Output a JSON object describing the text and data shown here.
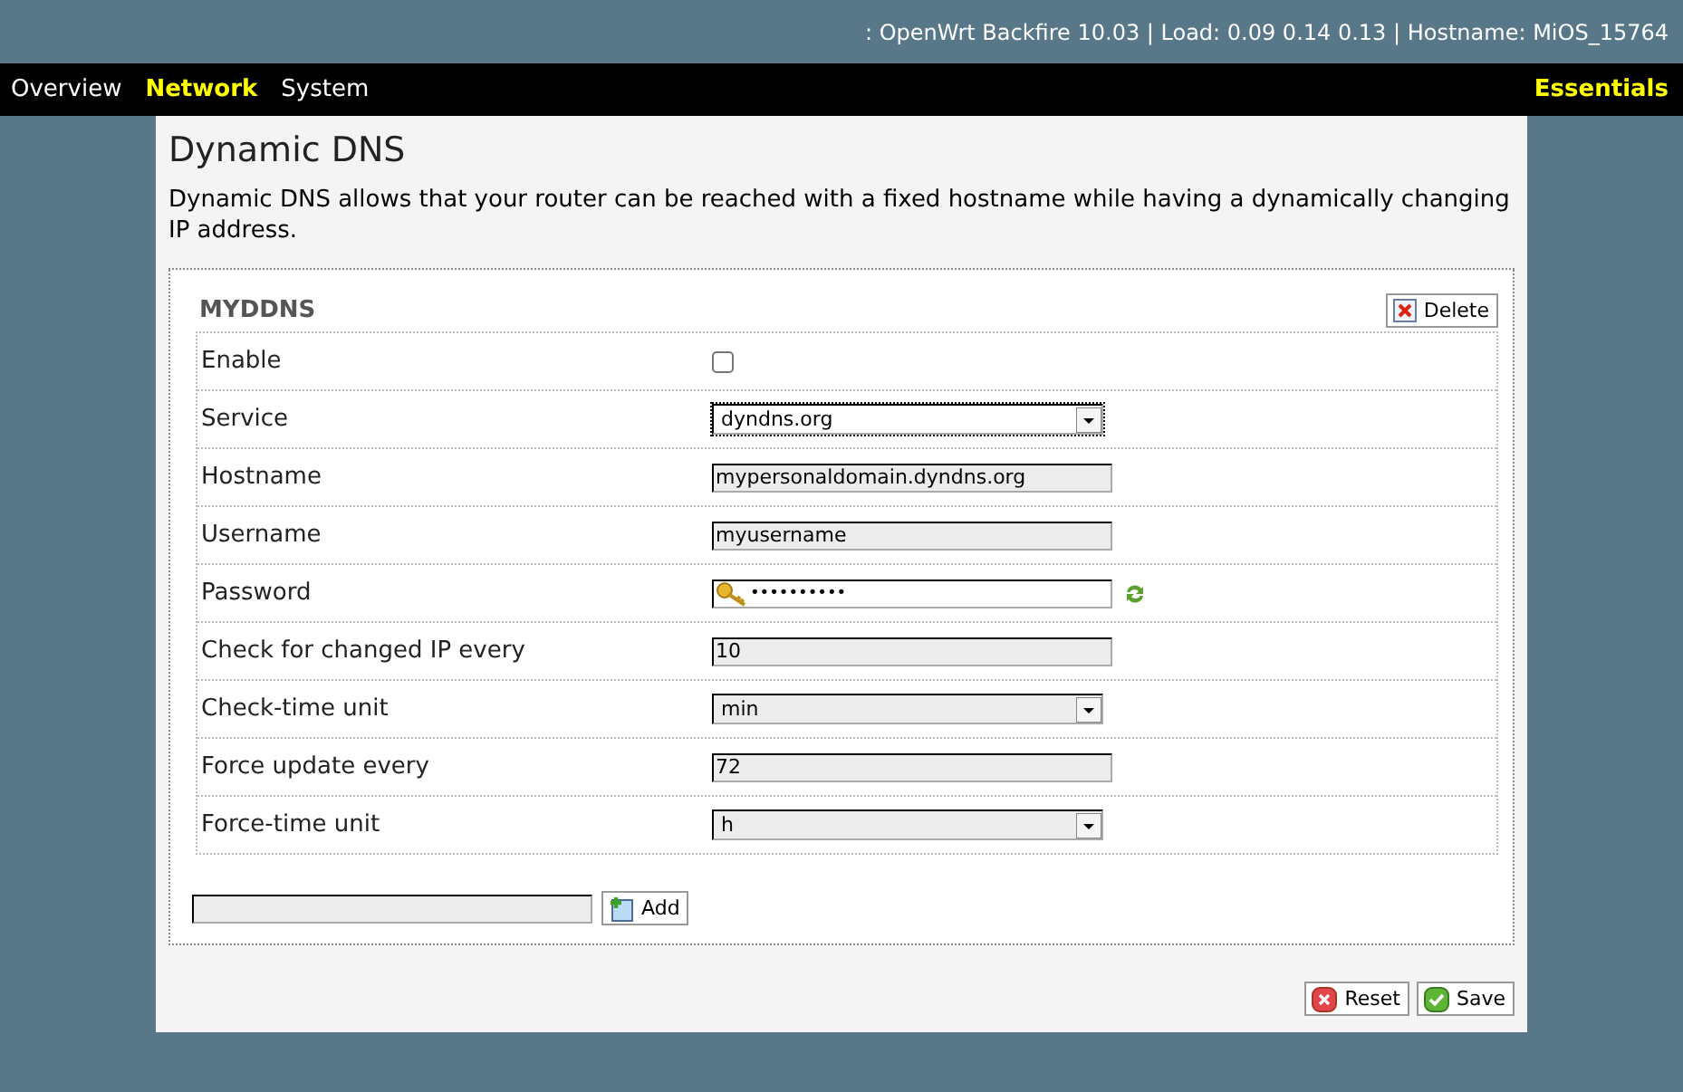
{
  "header": {
    "status": ": OpenWrt Backfire 10.03 | Load: 0.09 0.14 0.13 | Hostname: MiOS_15764"
  },
  "nav": {
    "items": [
      {
        "label": "Overview",
        "selected": false
      },
      {
        "label": "Network",
        "selected": true
      },
      {
        "label": "System",
        "selected": false
      }
    ],
    "mode": "Essentials"
  },
  "page": {
    "title": "Dynamic DNS",
    "description": "Dynamic DNS allows that your router can be reached with a fixed hostname while having a dynamically changing IP address."
  },
  "section": {
    "name": "MYDDNS",
    "delete_label": "Delete",
    "fields": [
      {
        "label": "Enable",
        "kind": "checkbox",
        "checked": false
      },
      {
        "label": "Service",
        "kind": "select",
        "value": "dyndns.org",
        "focused": true
      },
      {
        "label": "Hostname",
        "kind": "text",
        "value": "mypersonaldomain.dyndns.org"
      },
      {
        "label": "Username",
        "kind": "text",
        "value": "myusername"
      },
      {
        "label": "Password",
        "kind": "password",
        "value": "••••••••••"
      },
      {
        "label": "Check for changed IP every",
        "kind": "text",
        "value": "10"
      },
      {
        "label": "Check-time unit",
        "kind": "select",
        "value": "min",
        "focused": false
      },
      {
        "label": "Force update every",
        "kind": "text",
        "value": "72"
      },
      {
        "label": "Force-time unit",
        "kind": "select",
        "value": "h",
        "focused": false
      }
    ]
  },
  "add_label": "Add",
  "buttons": [
    {
      "kind": "reset",
      "label": "Reset"
    },
    {
      "kind": "save",
      "label": "Save"
    }
  ]
}
